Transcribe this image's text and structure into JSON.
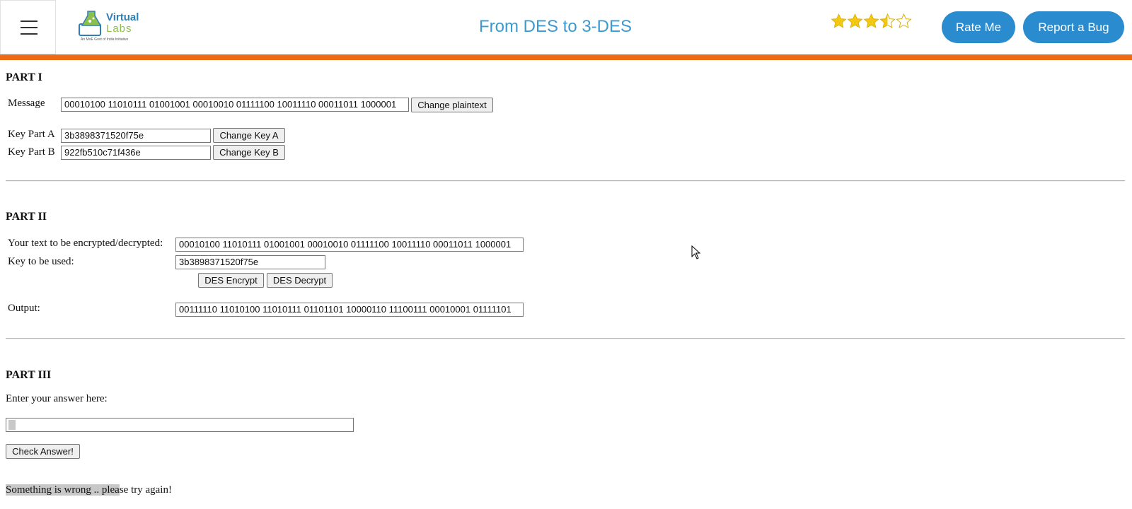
{
  "header": {
    "menu_icon": "hamburger-menu-icon",
    "logo_text_top": "Virtual",
    "logo_text_bottom": "Labs",
    "logo_tagline": "An MoE Govt of India Initiative",
    "title": "From DES to 3-DES",
    "rating": 3.5,
    "rating_max": 5,
    "rate_label": "Rate Me",
    "bug_label": "Report a Bug",
    "colors": {
      "accent_bar": "#ed6b15",
      "title": "#3a9bd0",
      "button": "#2a8bcf",
      "star": "#f2c811"
    }
  },
  "part1": {
    "heading": "PART I",
    "message_label": "Message",
    "message_value": "00010100 11010111 01001001 00010010 01111100 10011110 00011011 1000001",
    "change_plaintext_label": "Change plaintext",
    "key_a_label": "Key Part A",
    "key_a_value": "3b3898371520f75e",
    "change_key_a_label": "Change Key A",
    "key_b_label": "Key Part B",
    "key_b_value": "922fb510c71f436e",
    "change_key_b_label": "Change Key B"
  },
  "part2": {
    "heading": "PART II",
    "text_label": "Your text to be encrypted/decrypted:",
    "text_value": "00010100 11010111 01001001 00010010 01111100 10011110 00011011 1000001",
    "key_label": "Key to be used:",
    "key_value": "3b3898371520f75e",
    "encrypt_label": "DES Encrypt",
    "decrypt_label": "DES Decrypt",
    "output_label": "Output:",
    "output_value": "00111110 11010100 11010111 01101101 10000110 11100111 00010001 01111101"
  },
  "part3": {
    "heading": "PART III",
    "prompt": "Enter your answer here:",
    "answer_value": "",
    "check_label": "Check Answer!",
    "result_highlighted": "Something is wrong .. plea",
    "result_rest": "se try again!"
  }
}
